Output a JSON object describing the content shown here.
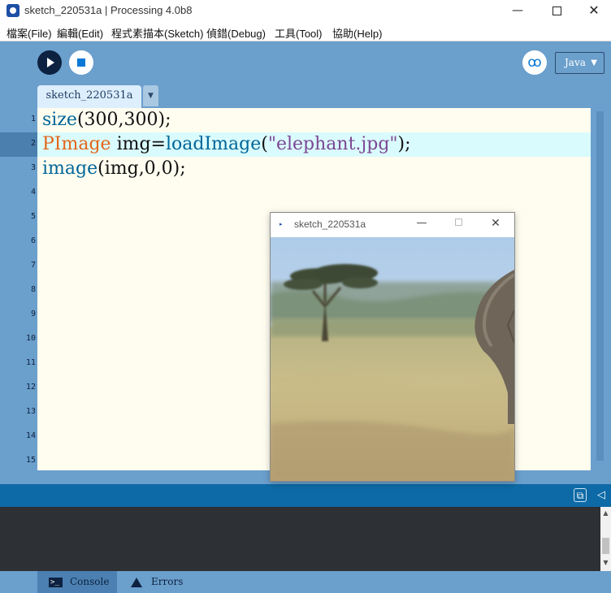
{
  "window": {
    "title": "sketch_220531a | Processing 4.0b8",
    "minimize": "—",
    "close": "✕"
  },
  "menu": [
    {
      "label": "檔案(File)"
    },
    {
      "label": "編輯(Edit)"
    },
    {
      "label": "程式素描本(Sketch)"
    },
    {
      "label": "偵錯(Debug)"
    },
    {
      "label": "工具(Tool)"
    },
    {
      "label": "協助(Help)"
    }
  ],
  "toolbar": {
    "run_icon": "play-icon",
    "stop_icon": "stop-icon",
    "debug_icon": "butterfly-debug-icon",
    "debug_glyph": "ꝏ",
    "mode": "Java",
    "mode_caret": "▼"
  },
  "tabs": [
    {
      "label": "sketch_220531a"
    }
  ],
  "tab_menu_glyph": "▼",
  "editor": {
    "line_numbers": [
      "1",
      "2",
      "3",
      "4",
      "5",
      "6",
      "7",
      "8",
      "9",
      "10",
      "11",
      "12",
      "13",
      "14",
      "15"
    ],
    "lines": [
      {
        "text": "size(300,300);",
        "tokens": [
          {
            "t": "size",
            "c": "fn"
          },
          {
            "t": "(300,300);",
            "c": "plain"
          }
        ]
      },
      {
        "text": "PImage img=loadImage(\"elephant.jpg\");",
        "tokens": [
          {
            "t": "PImage",
            "c": "type"
          },
          {
            "t": " img=",
            "c": "plain"
          },
          {
            "t": "loadImage",
            "c": "fn"
          },
          {
            "t": "(",
            "c": "plain"
          },
          {
            "t": "\"elephant.jpg\"",
            "c": "str"
          },
          {
            "t": ");",
            "c": "plain"
          }
        ]
      },
      {
        "text": "image(img,0,0);",
        "tokens": [
          {
            "t": "image",
            "c": "fn"
          },
          {
            "t": "(img,0,0);",
            "c": "plain"
          }
        ]
      }
    ],
    "highlighted_line": 2,
    "colors": {
      "fn": "#006699",
      "type": "#e2661a",
      "str": "#7d4793",
      "plain": "#111111"
    }
  },
  "status": {
    "console_copy_icon": "clipboard-icon",
    "console_copy_glyph": "⧉",
    "collapse_glyph": "◁"
  },
  "console_scroll": {
    "up": "▲",
    "down": "▼"
  },
  "footer_tabs": {
    "console": {
      "label": "Console",
      "icon": "terminal-icon",
      "glyph": ">_"
    },
    "errors": {
      "label": "Errors",
      "icon": "warning-icon"
    }
  },
  "sketch_window": {
    "title": "sketch_220531a",
    "icon_glyph": "▸",
    "minimize": "—",
    "close": "✕",
    "image_name": "elephant.jpg"
  },
  "colors": {
    "toolbar_bg": "#6b9fcc",
    "status_bg": "#0e6aa6",
    "console_bg": "#2d3034",
    "editor_bg": "#fffdf0",
    "line_highlight": "#dafbfd"
  }
}
